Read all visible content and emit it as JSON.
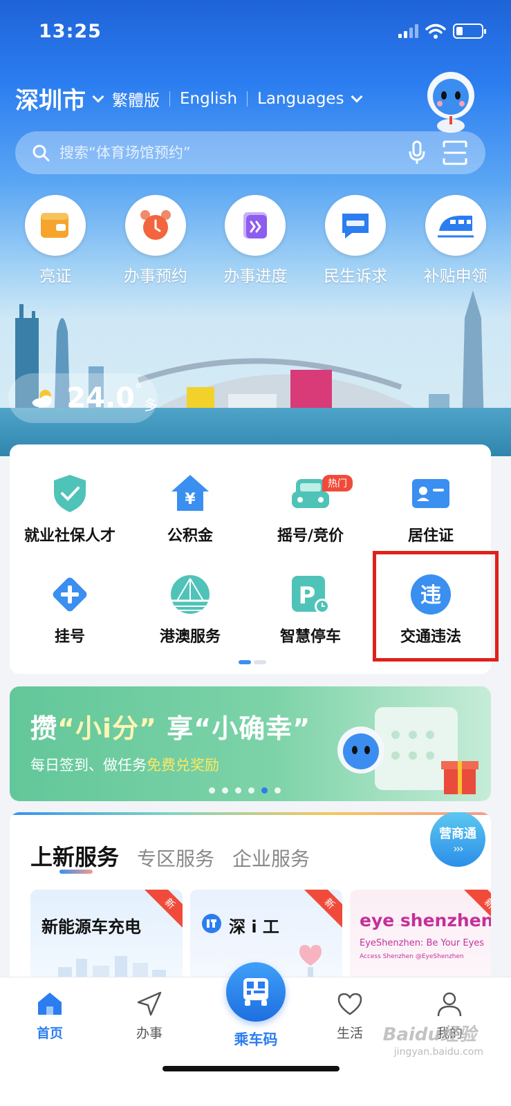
{
  "status_bar": {
    "time": "13:25",
    "battery_level": 0.25
  },
  "header": {
    "city": "深圳市",
    "traditional": "繁體版",
    "english": "English",
    "languages": "Languages"
  },
  "search": {
    "placeholder": "搜索“体育场馆预约”"
  },
  "quick_actions": [
    {
      "label": "亮证",
      "icon": "wallet-icon"
    },
    {
      "label": "办事预约",
      "icon": "alarm-clock-icon"
    },
    {
      "label": "办事进度",
      "icon": "progress-icon"
    },
    {
      "label": "民生诉求",
      "icon": "chat-icon"
    },
    {
      "label": "补贴申领",
      "icon": "train-icon"
    }
  ],
  "weather": {
    "temp": "24.0",
    "deg": "°",
    "desc": "多"
  },
  "services": [
    {
      "label": "就业社保人才",
      "icon": "shield-check-icon"
    },
    {
      "label": "公积金",
      "icon": "house-yen-icon"
    },
    {
      "label": "摇号/竞价",
      "icon": "car-icon",
      "badge": "热门"
    },
    {
      "label": "居住证",
      "icon": "id-card-icon"
    },
    {
      "label": "挂号",
      "icon": "medical-cross-icon"
    },
    {
      "label": "港澳服务",
      "icon": "bridge-icon"
    },
    {
      "label": "智慧停车",
      "icon": "parking-icon"
    },
    {
      "label": "交通违法",
      "icon": "traffic-violation-icon",
      "glyph": "违"
    }
  ],
  "banner": {
    "title_a": "攒",
    "title_b": "“小i分”",
    "title_c": " 享“小确幸”",
    "sub_a": "每日签到、做任务",
    "sub_b": "免费兑奖励"
  },
  "new_services": {
    "tabs": [
      "上新服务",
      "专区服务",
      "企业服务"
    ],
    "ysb_label": "营商通",
    "ysb_arrows": "›››",
    "cards": [
      {
        "title": "新能源车充电",
        "tag": "新"
      },
      {
        "title": "深 i 工",
        "tag": "新"
      },
      {
        "title": "eye shenzhen",
        "subtitle": "EyeShenzhen: Be Your Eyes",
        "subtitle2": "Access Shenzhen @EyeShenzhen",
        "tag": "新"
      }
    ]
  },
  "nav": {
    "home": "首页",
    "services": "办事",
    "ride": "乘车码",
    "life": "生活",
    "me": "我的"
  },
  "watermark": {
    "main": "Baidu经验",
    "sub": "jingyan.baidu.com"
  },
  "colors": {
    "primary": "#2b7df0",
    "highlight": "#e0201b",
    "hot": "#f04b3a"
  }
}
